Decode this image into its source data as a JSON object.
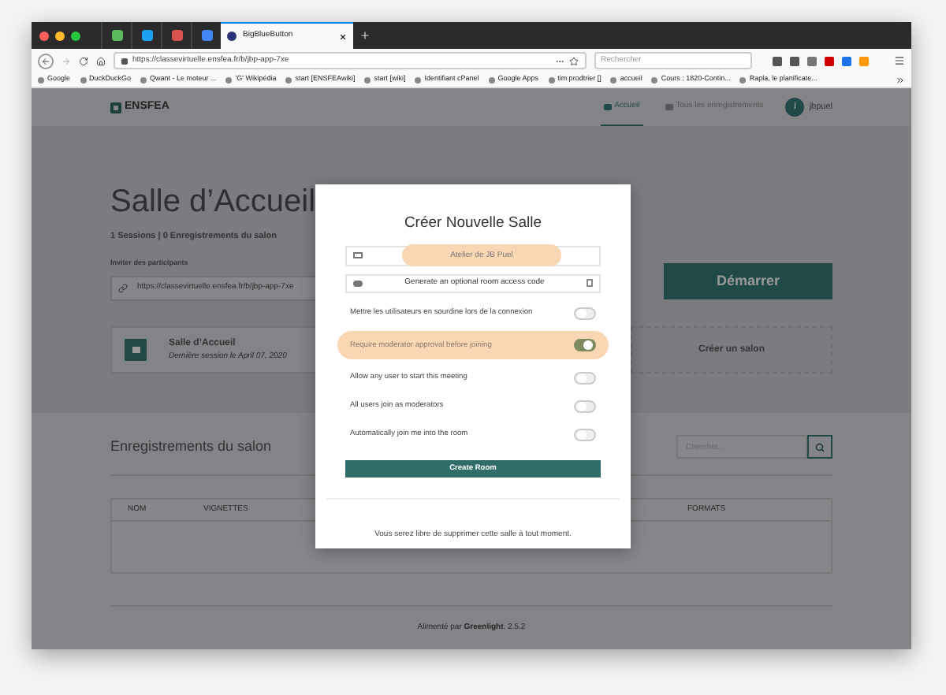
{
  "browser": {
    "tabs": [
      {
        "title": "BigBlueButton",
        "selected": true
      }
    ],
    "url": "https://classevirtuelle.ensfea.fr/b/jbp-app-7xe",
    "search": {
      "placeholder": "Rechercher"
    },
    "bookmarks": [
      "Google",
      "DuckDuckGo",
      "Qwant - Le moteur ...",
      "'G' Wikipédia",
      "start [ENSFEAwiki]",
      "start [wiki]",
      "Identifiant cPanel",
      "Google Apps",
      "tim prodtrier []",
      "accueil",
      "Cours : 1820-Contin...",
      "Rapla, le planificate..."
    ]
  },
  "nav": {
    "logo": "ENSFEA",
    "items": [
      {
        "label": "Accueil",
        "selected": true
      },
      {
        "label": "Tous les enregistrements",
        "selected": false
      }
    ],
    "user": {
      "initial": "j",
      "name": "jbpuel"
    }
  },
  "room": {
    "title": "Salle d’Accueil",
    "stats": "1 Sessions | 0 Enregistrements du salon",
    "invite_label": "Inviter des participants",
    "invite_url": "https://classevirtuelle.ensfea.fr/b/jbp-app-7xe",
    "start_button": "Démarrer",
    "card_title": "Salle d’Accueil",
    "card_subtitle": "Dernière session le April 07, 2020",
    "create_card": "Créer un salon"
  },
  "recordings": {
    "title": "Enregistrements du salon",
    "search": {
      "placeholder": "Chercher..."
    },
    "columns": [
      "NOM",
      "VIGNETTES",
      "FORMATS"
    ]
  },
  "footer": "Alimenté par **Greenlight**. 2.5.2",
  "modal": {
    "title": "Créer Nouvelle Salle",
    "name_field": {
      "value": "Atelier de JB Puel",
      "highlighted": true
    },
    "access_code": "Generate an optional room access code",
    "options": [
      {
        "label": "Mettre les utilisateurs en sourdine lors de la connexion",
        "on": false,
        "highlighted": false
      },
      {
        "label": "Require moderator approval before joining",
        "on": true,
        "highlighted": true
      },
      {
        "label": "Allow any user to start this meeting",
        "on": false,
        "highlighted": false
      },
      {
        "label": "All users join as moderators",
        "on": false,
        "highlighted": false
      },
      {
        "label": "Automatically join me into the room",
        "on": false,
        "highlighted": false
      }
    ],
    "submit": "Create Room",
    "note": "Vous serez libre de supprimer cette salle à tout moment."
  }
}
